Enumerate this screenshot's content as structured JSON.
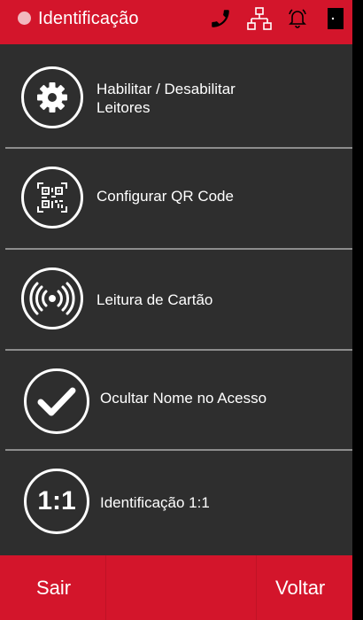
{
  "header": {
    "title": "Identificação",
    "icons": [
      "phone-icon",
      "network-icon",
      "bell-icon",
      "door-icon"
    ]
  },
  "menu": {
    "items": [
      {
        "label_line1": "Habilitar / Desabilitar",
        "label_line2": "Leitores",
        "icon": "gear-icon"
      },
      {
        "label": "Configurar QR Code",
        "icon": "qr-code-icon"
      },
      {
        "label": "Leitura de Cartão",
        "icon": "rfid-signal-icon"
      },
      {
        "label": "Ocultar Nome no Acesso",
        "icon": "checkmark-icon"
      },
      {
        "label": "Identificação 1:1",
        "icon": "one-to-one-icon",
        "icon_text": "1:1"
      }
    ]
  },
  "footer": {
    "exit_label": "Sair",
    "back_label": "Voltar"
  },
  "colors": {
    "accent": "#d3152b",
    "panel": "#2e2e2e",
    "divider": "#8c8c8c",
    "status_dot": "#f2b8bf"
  }
}
